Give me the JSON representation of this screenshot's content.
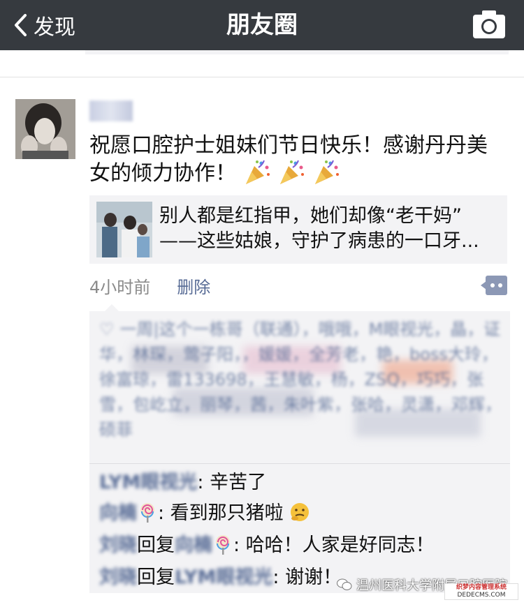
{
  "nav": {
    "back_label": "发现",
    "title": "朋友圈",
    "back_icon": "chevron-left-icon",
    "camera_icon": "camera-icon"
  },
  "post": {
    "text": "祝愿口腔护士姐妹们节日快乐！感谢丹丹美女的倾力协作！",
    "emoji": [
      "party-popper",
      "party-popper",
      "party-popper"
    ],
    "link": {
      "title_line1": "别人都是红指甲，她们却像“老干妈”",
      "title_line2": "——这些姑娘，守护了病患的一口牙..."
    },
    "time": "4小时前",
    "delete_label": "删除"
  },
  "likes": {
    "text": "一周|这个一栋哥（联通），哦哦，M眼视光，晶，证华，林琛，莺子阳，，媛媛，全芳老，艳，boss大玲，徐富琼，雷133698，王慧敏，杨，ZSQ，巧巧，张雪，包屹立，丽琴，茜，朱叶紫，张哈，灵潇，邓辉，硕菲"
  },
  "comments": [
    {
      "name": "LYM眼视光",
      "text": ": 辛苦了"
    },
    {
      "name": "向楠",
      "text": ": 看到那只猪啦"
    },
    {
      "name": "刘晓",
      "reply_word": "回复",
      "reply_to": "向楠",
      "text": ": 哈哈！人家是好同志！"
    },
    {
      "name": "刘晓",
      "reply_word": "回复",
      "reply_to": "LYM眼视光",
      "text": ": 谢谢！"
    }
  ],
  "watermark": {
    "text": "温州医科大学附属口腔医院",
    "site_line1": "织梦内容管理系统",
    "site_line2": "DEDECMS.COM"
  },
  "colors": {
    "navbar": "#363a3f",
    "link_blue": "#576b95",
    "card_bg": "#f3f3f5"
  }
}
